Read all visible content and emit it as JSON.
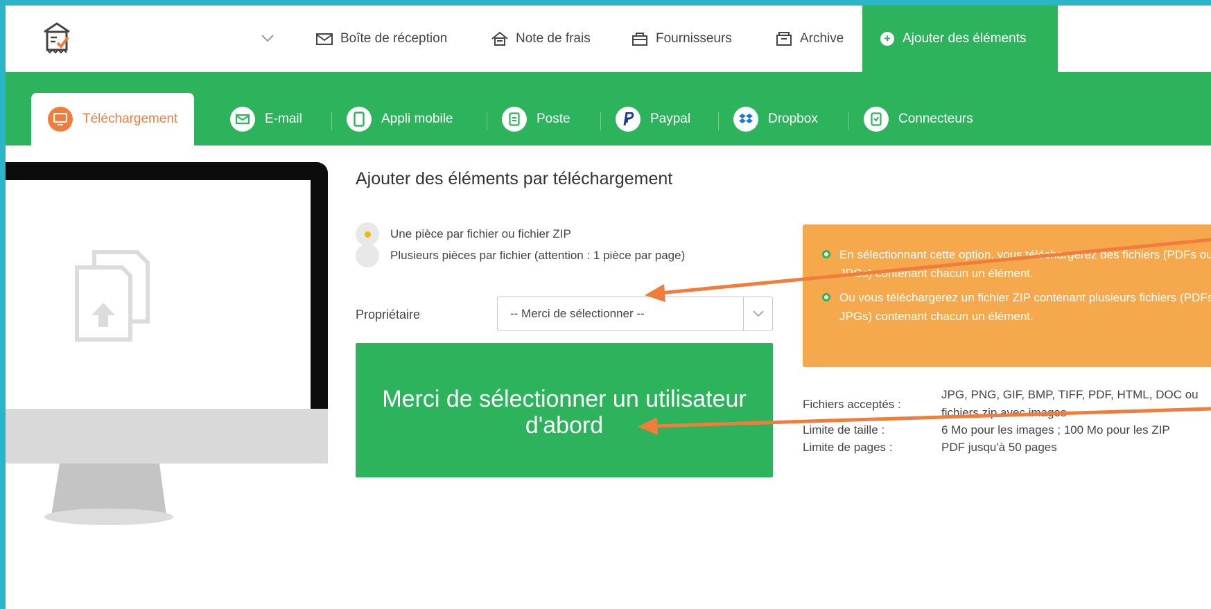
{
  "nav": {
    "items": [
      {
        "label": "Boîte de réception",
        "icon": "inbox-icon"
      },
      {
        "label": "Note de frais",
        "icon": "expense-icon"
      },
      {
        "label": "Fournisseurs",
        "icon": "suppliers-icon"
      },
      {
        "label": "Archive",
        "icon": "archive-icon"
      }
    ],
    "active": {
      "label": "Ajouter des éléments",
      "icon": "plus-circle-icon"
    }
  },
  "tabs": [
    {
      "label": "Téléchargement",
      "icon": "desktop-icon",
      "active": true
    },
    {
      "label": "E-mail",
      "icon": "envelope-icon"
    },
    {
      "label": "Appli mobile",
      "icon": "mobile-icon"
    },
    {
      "label": "Poste",
      "icon": "letter-icon"
    },
    {
      "label": "Paypal",
      "icon": "paypal-icon"
    },
    {
      "label": "Dropbox",
      "icon": "dropbox-icon"
    },
    {
      "label": "Connecteurs",
      "icon": "connectors-icon"
    }
  ],
  "main": {
    "title": "Ajouter des éléments par téléchargement",
    "radio_options": [
      {
        "label": "Une pièce par fichier ou fichier ZIP",
        "selected": true
      },
      {
        "label": "Plusieurs pièces par fichier (attention : 1 pièce par page)",
        "selected": false
      }
    ],
    "owner_label": "Propriétaire",
    "owner_select_value": "-- Merci de sélectionner --",
    "upload_button": "Merci de sélectionner un utilisateur d'abord"
  },
  "info": {
    "items": [
      "En sélectionnant cette option, vous téléchargerez des fichiers (PDFs ou JPGs) contenant chacun un élément.",
      "Ou vous téléchargerez un fichier ZIP contenant plusieurs fichiers (PDFs ou JPGs) contenant chacun un élément."
    ]
  },
  "specs": {
    "accepted_label": "Fichiers acceptés :",
    "accepted_value_line1": "JPG, PNG, GIF, BMP, TIFF, PDF, HTML, DOC ou",
    "accepted_value_line2": "fichiers zip avec images",
    "size_label": "Limite de taille :",
    "size_value": "6 Mo pour les images ; 100 Mo pour les ZIP",
    "pages_label": "Limite de pages :",
    "pages_value": "PDF jusqu'à 50 pages"
  },
  "colors": {
    "green": "#2db35b",
    "orange": "#f07d3c",
    "info_bg": "#f5a94c",
    "border": "#2bb5c8"
  }
}
